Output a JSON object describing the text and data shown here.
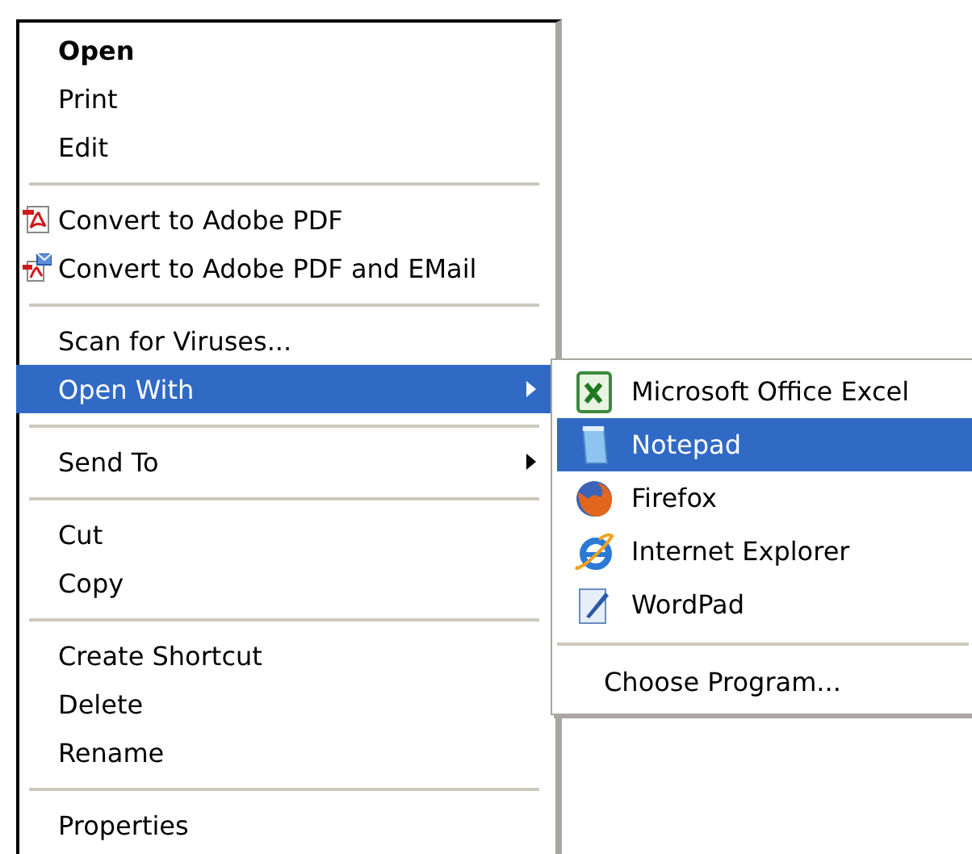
{
  "context_menu": {
    "items": [
      {
        "kind": "item",
        "label": "Open",
        "default": true,
        "selected": false
      },
      {
        "kind": "item",
        "label": "Print",
        "default": false,
        "selected": false
      },
      {
        "kind": "item",
        "label": "Edit",
        "default": false,
        "selected": false
      },
      {
        "kind": "separator"
      },
      {
        "kind": "icon",
        "label": "Convert to Adobe PDF",
        "default": false,
        "selected": false
      },
      {
        "kind": "icon",
        "label": "Convert to Adobe PDF and EMail",
        "default": false,
        "selected": false
      },
      {
        "kind": "separator"
      },
      {
        "kind": "item",
        "label": "Scan for Viruses...",
        "default": false,
        "selected": false
      },
      {
        "kind": "submenu",
        "label": "Open With",
        "default": false,
        "selected": true
      },
      {
        "kind": "separator"
      },
      {
        "kind": "submenu",
        "label": "Send To",
        "default": false,
        "selected": false
      },
      {
        "kind": "separator"
      },
      {
        "kind": "item",
        "label": "Cut",
        "default": false,
        "selected": false
      },
      {
        "kind": "item",
        "label": "Copy",
        "default": false,
        "selected": false
      },
      {
        "kind": "separator"
      },
      {
        "kind": "item",
        "label": "Create Shortcut",
        "default": false,
        "selected": false
      },
      {
        "kind": "item",
        "label": "Delete",
        "default": false,
        "selected": false
      },
      {
        "kind": "item",
        "label": "Rename",
        "default": false,
        "selected": false
      },
      {
        "kind": "separator"
      },
      {
        "kind": "item",
        "label": "Properties",
        "default": false,
        "selected": false
      }
    ]
  },
  "open_with_submenu": {
    "items": [
      {
        "kind": "icon",
        "label": "Microsoft Office Excel",
        "selected": false
      },
      {
        "kind": "icon",
        "label": "Notepad",
        "selected": true
      },
      {
        "kind": "icon",
        "label": "Firefox",
        "selected": false
      },
      {
        "kind": "icon",
        "label": "Internet Explorer",
        "selected": false
      },
      {
        "kind": "icon",
        "label": "WordPad",
        "selected": false
      },
      {
        "kind": "separator"
      },
      {
        "kind": "item",
        "label": "Choose Program...",
        "selected": false
      }
    ]
  }
}
